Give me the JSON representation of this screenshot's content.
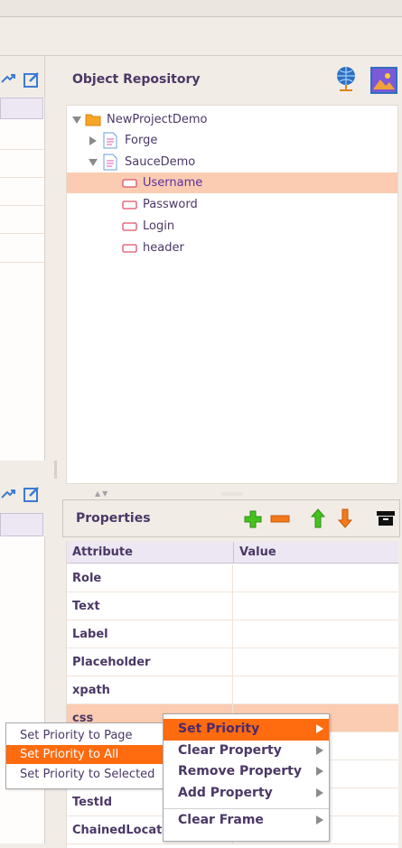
{
  "object_repository": {
    "title": "Object Repository",
    "tree": [
      {
        "label": "NewProjectDemo",
        "icon": "folder-icon",
        "expanded": true
      },
      {
        "label": "Forge",
        "icon": "page-icon",
        "expanded": false
      },
      {
        "label": "SauceDemo",
        "icon": "page-icon",
        "expanded": true
      },
      {
        "label": "Username",
        "icon": "element-icon",
        "selected": true
      },
      {
        "label": "Password",
        "icon": "element-icon"
      },
      {
        "label": "Login",
        "icon": "element-icon"
      },
      {
        "label": "header",
        "icon": "element-icon"
      }
    ]
  },
  "properties": {
    "title": "Properties",
    "columns": [
      "Attribute",
      "Value"
    ],
    "rows": [
      {
        "attribute": "Role",
        "value": ""
      },
      {
        "attribute": "Text",
        "value": ""
      },
      {
        "attribute": "Label",
        "value": ""
      },
      {
        "attribute": "Placeholder",
        "value": ""
      },
      {
        "attribute": "xpath",
        "value": ""
      },
      {
        "attribute": "css",
        "value": ""
      },
      {
        "attribute": "",
        "value": ""
      },
      {
        "attribute": "",
        "value": ""
      },
      {
        "attribute": "TestId",
        "value": ""
      },
      {
        "attribute": "ChainedLocator",
        "value": ""
      }
    ]
  },
  "context_menu": {
    "items": [
      {
        "label": "Set Priority",
        "highlighted": true
      },
      {
        "label": "Clear Property"
      },
      {
        "label": "Remove Property"
      },
      {
        "label": "Add Property"
      },
      {
        "label": "Clear Frame"
      }
    ]
  },
  "priority_submenu": {
    "items": [
      {
        "label": "Set Priority to Page"
      },
      {
        "label": "Set Priority to All",
        "highlighted": true
      },
      {
        "label": "Set Priority to Selected"
      }
    ]
  },
  "colors": {
    "accent": "#ff6b0f",
    "selection": "#fbccb1",
    "title_text": "#4b3866"
  }
}
